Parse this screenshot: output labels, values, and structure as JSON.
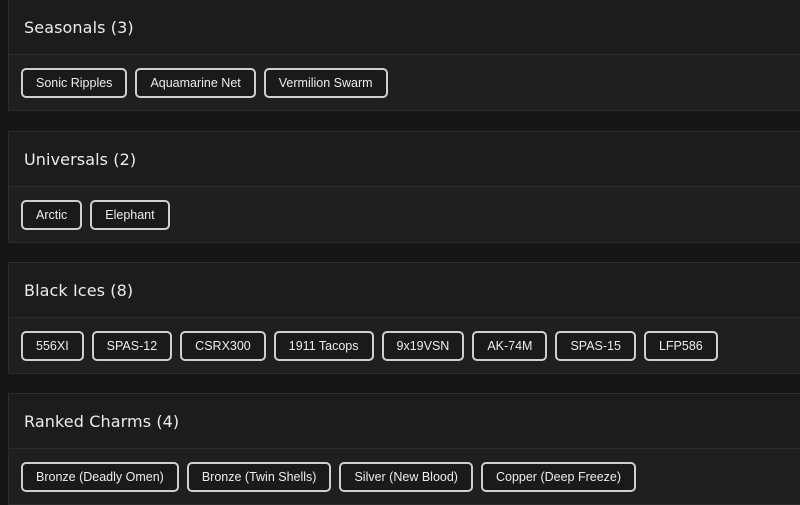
{
  "sections": [
    {
      "title": "Seasonals (3)",
      "items": [
        "Sonic Ripples",
        "Aquamarine Net",
        "Vermilion Swarm"
      ]
    },
    {
      "title": "Universals (2)",
      "items": [
        "Arctic",
        "Elephant"
      ]
    },
    {
      "title": "Black Ices (8)",
      "items": [
        "556XI",
        "SPAS-12",
        "CSRX300",
        "1911 Tacops",
        "9x19VSN",
        "AK-74M",
        "SPAS-15",
        "LFP586"
      ]
    },
    {
      "title": "Ranked Charms (4)",
      "items": [
        "Bronze (Deadly Omen)",
        "Bronze (Twin Shells)",
        "Silver (New Blood)",
        "Copper (Deep Freeze)"
      ]
    }
  ]
}
